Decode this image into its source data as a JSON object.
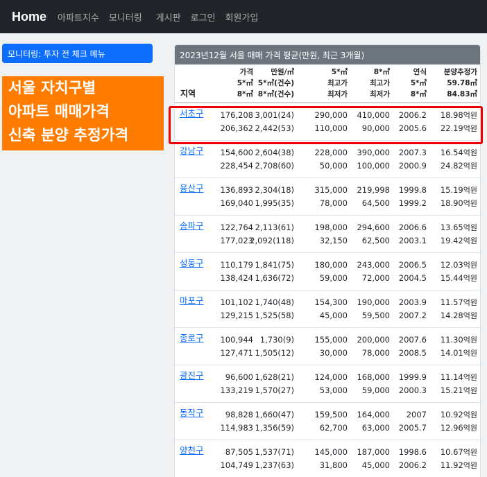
{
  "nav": {
    "brand": "Home",
    "items": [
      "아파트지수",
      "모니터링",
      "게시판",
      "로그인",
      "회원가입"
    ]
  },
  "sidebar": {
    "button_label": "모니터링: 투자 전 체크 메뉴",
    "promo_lines": [
      "서울 자치구별",
      "아파트 매매가격",
      "신축 분양 추정가격"
    ]
  },
  "colors": {
    "navbar": "#212529",
    "primary": "#0d6efd",
    "promo": "#ff7c00",
    "header": "#6c757d",
    "highlight": "#ee0000"
  },
  "table": {
    "title": "2023년12월 서울 매매 가격 평균(만원, 최근 3개월)",
    "region_header": "지역",
    "headers": [
      [
        "가격",
        "5*㎡",
        "8*㎡"
      ],
      [
        "만원/㎡",
        "5*㎡(건수)",
        "8*㎡(건수)"
      ],
      [
        "5*㎡",
        "최고가",
        "최저가"
      ],
      [
        "8*㎡",
        "최고가",
        "최저가"
      ],
      [
        "연식",
        "5*㎡",
        "8*㎡"
      ],
      [
        "분양추정가",
        "59.78㎡",
        "84.83㎡"
      ]
    ],
    "unit": "억원",
    "rows": [
      {
        "region": "서초구",
        "r1": [
          "176,208",
          "3,001(24)",
          "290,000",
          "410,000",
          "2006.2",
          "18.98"
        ],
        "r2": [
          "206,362",
          "2,442(53)",
          "110,000",
          "90,000",
          "2005.6",
          "22.19"
        ]
      },
      {
        "region": "강남구",
        "r1": [
          "154,600",
          "2,604(38)",
          "228,000",
          "390,000",
          "2007.3",
          "16.54"
        ],
        "r2": [
          "228,454",
          "2,708(60)",
          "50,000",
          "100,000",
          "2000.9",
          "24.82"
        ]
      },
      {
        "region": "용산구",
        "r1": [
          "136,893",
          "2,304(18)",
          "315,000",
          "219,998",
          "1999.8",
          "15.19"
        ],
        "r2": [
          "169,040",
          "1,995(35)",
          "78,000",
          "64,500",
          "1999.2",
          "18.90"
        ]
      },
      {
        "region": "송파구",
        "r1": [
          "122,764",
          "2,113(61)",
          "198,000",
          "294,600",
          "2006.6",
          "13.65"
        ],
        "r2": [
          "177,023",
          "2,092(118)",
          "32,150",
          "62,500",
          "2003.1",
          "19.42"
        ]
      },
      {
        "region": "성동구",
        "r1": [
          "110,179",
          "1,841(75)",
          "180,000",
          "243,000",
          "2006.5",
          "12.03"
        ],
        "r2": [
          "138,424",
          "1,636(72)",
          "59,000",
          "72,000",
          "2004.5",
          "15.44"
        ]
      },
      {
        "region": "마포구",
        "r1": [
          "101,102",
          "1,740(48)",
          "154,300",
          "190,000",
          "2003.9",
          "11.57"
        ],
        "r2": [
          "129,215",
          "1,525(58)",
          "45,000",
          "59,500",
          "2007.2",
          "14.28"
        ]
      },
      {
        "region": "종로구",
        "r1": [
          "100,944",
          "1,730(9)",
          "155,000",
          "200,000",
          "2007.6",
          "11.30"
        ],
        "r2": [
          "127,471",
          "1,505(12)",
          "30,000",
          "78,000",
          "2008.5",
          "14.01"
        ]
      },
      {
        "region": "광진구",
        "r1": [
          "96,600",
          "1,628(21)",
          "124,000",
          "168,000",
          "1999.9",
          "11.14"
        ],
        "r2": [
          "133,219",
          "1,570(27)",
          "53,000",
          "59,000",
          "2000.3",
          "15.21"
        ]
      },
      {
        "region": "동작구",
        "r1": [
          "98,828",
          "1,660(47)",
          "159,500",
          "164,000",
          "2007",
          "10.92"
        ],
        "r2": [
          "114,983",
          "1,356(59)",
          "62,700",
          "63,000",
          "2005.7",
          "12.96"
        ]
      },
      {
        "region": "양천구",
        "r1": [
          "87,505",
          "1,537(71)",
          "145,000",
          "187,000",
          "1998.6",
          "10.67"
        ],
        "r2": [
          "104,749",
          "1,237(63)",
          "31,800",
          "45,000",
          "2006.2",
          "11.92"
        ]
      }
    ]
  }
}
